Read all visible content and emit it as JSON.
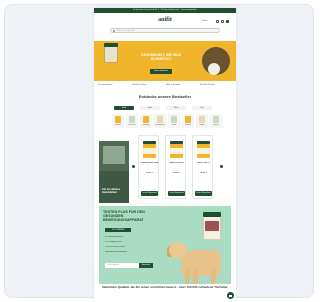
{
  "topbar": {
    "text": "Kostenloser Versand ab 49 € · 30 Tage Geld-zurück · Tierarztempfohlen"
  },
  "header": {
    "logo": "anifit",
    "account_label": "Konto"
  },
  "search": {
    "placeholder": "Wonach suchst du?"
  },
  "hero": {
    "headline": "GESUNDHEIT, DIE MAN SCHMECKT",
    "cta": "Jetzt entdecken"
  },
  "benefits": [
    "Tierarztempfohlen",
    "Natürliche Zutaten",
    "Made in Germany",
    "Schneller Versand"
  ],
  "bestseller": {
    "title": "Entdecke unsere Bestseller",
    "tabs": [
      "Hund",
      "Katze",
      "Pferd",
      "Sets"
    ],
    "active_tab": 0,
    "categories": [
      "Gelenke",
      "Haut & Fell",
      "Verdauung",
      "Immunsystem",
      "Zähne",
      "Senioren",
      "Welpen",
      "Snacks"
    ]
  },
  "lifestyle": {
    "caption": "Für ein aktives Hundeleben"
  },
  "products": [
    {
      "name": "Gelenk Pulver Hund",
      "price": "29,90 €",
      "button": "In den Warenkorb"
    },
    {
      "name": "Darm Kur Pulver",
      "price": "34,90 €",
      "button": "In den Warenkorb"
    },
    {
      "name": "Haut & Fell Öl",
      "price": "24,90 €",
      "button": "In den Warenkorb"
    }
  ],
  "promo": {
    "headline": "TESTEN PLUS FÜR DEN GESUNDEN BEWEGUNGSAPPARAT",
    "badge": "15% SPAREN",
    "features": [
      "Für Hunde jeden Alters",
      "Mit Grünlippmuschel",
      "Ohne künstliche Zusätze",
      "Wissenschaftlich entwickelt"
    ],
    "input_placeholder": "E-Mail-Adresse",
    "button": "Anmelden"
  },
  "footer": {
    "text": "Natürliche Qualität, die Du sehen und fühlen kannst – über 100.000 zufriedene Tierhalter"
  },
  "colors": {
    "brand_green": "#1f4f30",
    "accent_yellow": "#f0b52a",
    "promo_mint": "#a9dcc2"
  }
}
